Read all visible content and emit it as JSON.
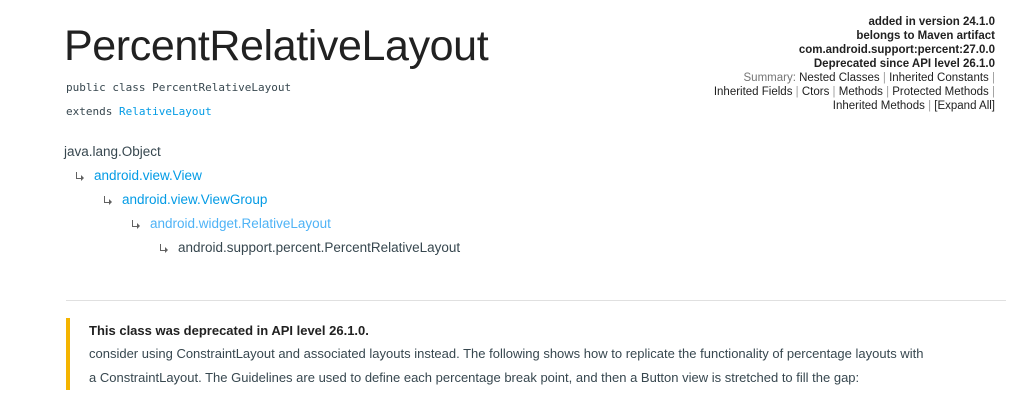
{
  "header": {
    "title": "PercentRelativeLayout",
    "signature_line1": "public class PercentRelativeLayout",
    "signature_extends_keyword": "extends",
    "signature_extends_link": "RelativeLayout"
  },
  "meta": {
    "added_in_version": "added in version 24.1.0",
    "belongs_to": "belongs to Maven artifact",
    "artifact": "com.android.support:percent:27.0.0",
    "deprecated_since": "Deprecated since API level 26.1.0",
    "summary_label": "Summary:",
    "summary_links": [
      "Nested Classes",
      "Inherited Constants",
      "Inherited Fields",
      "Ctors",
      "Methods",
      "Protected Methods",
      "Inherited Methods",
      "[Expand All]"
    ]
  },
  "inheritance": {
    "root": "java.lang.Object",
    "level1": "android.view.View",
    "level2": "android.view.ViewGroup",
    "level3": "android.widget.RelativeLayout",
    "level4": "android.support.percent.PercentRelativeLayout"
  },
  "deprecation": {
    "heading": "This class was deprecated in API level 26.1.0.",
    "line1": "consider using ConstraintLayout and associated layouts instead. The following shows how to replicate the functionality of percentage layouts with",
    "line2": "a ConstraintLayout. The Guidelines are used to define each percentage break point, and then a Button view is stretched to fill the gap:"
  },
  "colors": {
    "link": "#039be5",
    "callout_border": "#f4b400",
    "divider": "#e0e0e0"
  }
}
